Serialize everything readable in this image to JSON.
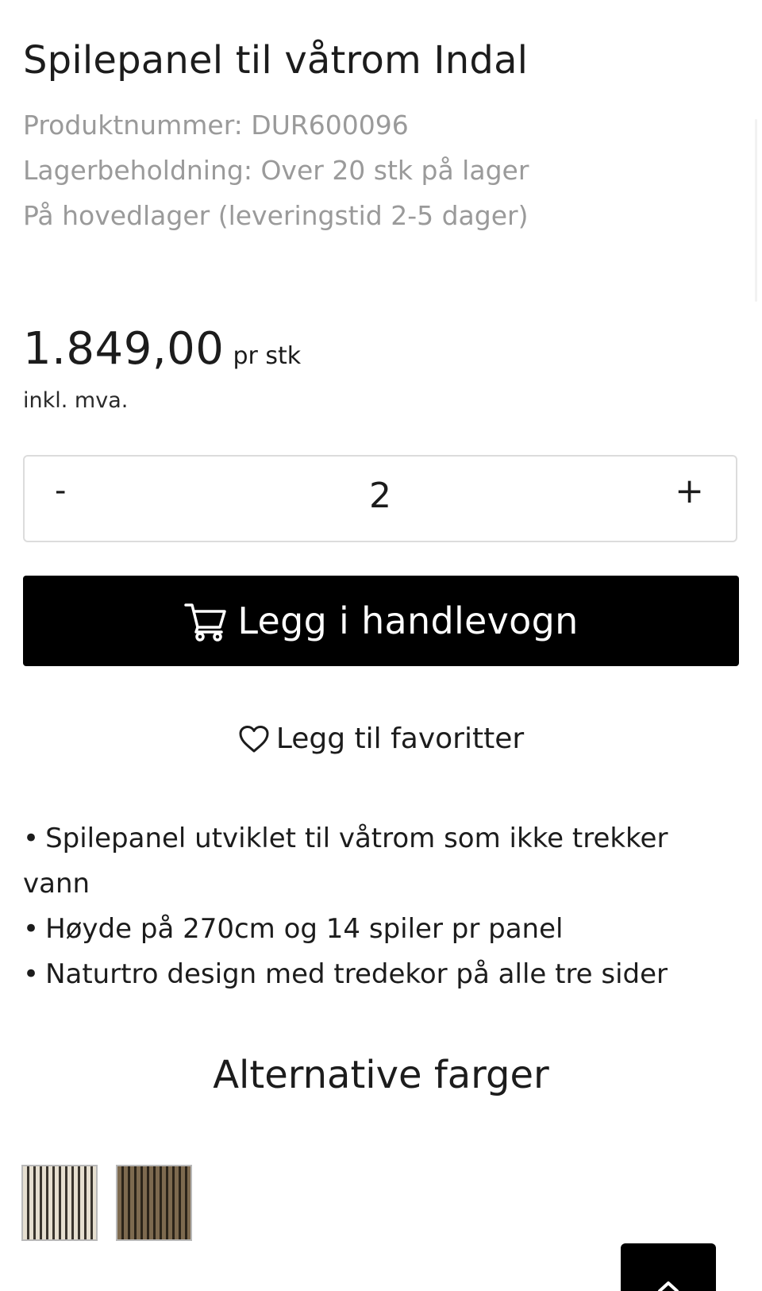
{
  "product": {
    "title": "Spilepanel til våtrom Indal",
    "product_number": "Produktnummer: DUR600096",
    "stock": "Lagerbeholdning: Over 20 stk på lager",
    "delivery": "På hovedlager (leveringstid 2-5 dager)",
    "price": "1.849,00",
    "price_unit": "pr stk",
    "vat_note": "inkl. mva."
  },
  "quantity": {
    "minus_label": "-",
    "value": "2",
    "plus_label": "+"
  },
  "cart": {
    "label": "Legg i handlevogn",
    "icon": "cart-icon"
  },
  "favorites": {
    "label": "Legg til favoritter",
    "icon": "heart-icon"
  },
  "features": [
    "Spilepanel utviklet til våtrom som ikke trekker vann",
    "Høyde på 270cm og 14 spiler pr panel",
    "Naturtro design med tredekor på alle tre sider"
  ],
  "alternatives": {
    "title": "Alternative farger",
    "swatches": [
      {
        "name": "light-oak",
        "color": "#e6dfd0"
      },
      {
        "name": "dark-oak",
        "color": "#7d6a4f"
      }
    ]
  },
  "back_to_top": {
    "icon": "chevron-up-icon"
  },
  "colors": {
    "primary_button": "#000000",
    "muted_text": "#9a9a9a",
    "border": "#dcdcdc"
  }
}
